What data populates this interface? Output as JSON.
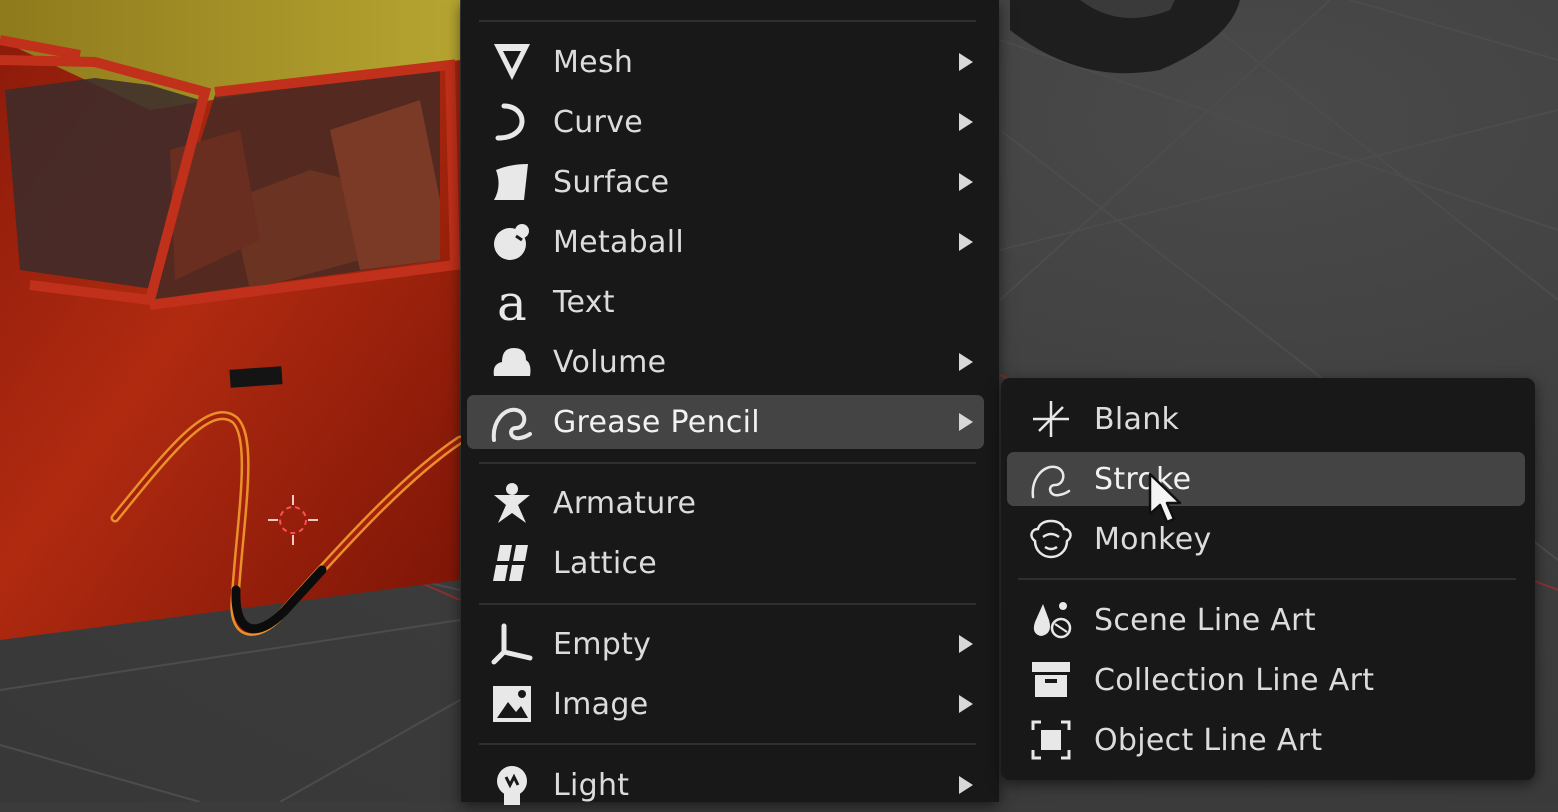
{
  "main_menu": {
    "items": [
      {
        "label": "Mesh",
        "icon": "mesh-icon",
        "submenu": true
      },
      {
        "label": "Curve",
        "icon": "curve-icon",
        "submenu": true
      },
      {
        "label": "Surface",
        "icon": "surface-icon",
        "submenu": true
      },
      {
        "label": "Metaball",
        "icon": "metaball-icon",
        "submenu": true
      },
      {
        "label": "Text",
        "icon": "text-icon",
        "submenu": false
      },
      {
        "label": "Volume",
        "icon": "volume-icon",
        "submenu": true
      },
      {
        "label": "Grease Pencil",
        "icon": "grease-pencil-icon",
        "submenu": true,
        "highlighted": true
      },
      {
        "label": "Armature",
        "icon": "armature-icon",
        "submenu": false
      },
      {
        "label": "Lattice",
        "icon": "lattice-icon",
        "submenu": false
      },
      {
        "label": "Empty",
        "icon": "empty-icon",
        "submenu": true
      },
      {
        "label": "Image",
        "icon": "image-icon",
        "submenu": true
      },
      {
        "label": "Light",
        "icon": "light-icon",
        "submenu": true
      }
    ]
  },
  "grease_pencil_menu": {
    "items": [
      {
        "label": "Blank",
        "icon": "blank-icon"
      },
      {
        "label": "Stroke",
        "icon": "stroke-icon",
        "highlighted": true
      },
      {
        "label": "Monkey",
        "icon": "monkey-icon"
      },
      {
        "label": "Scene Line Art",
        "icon": "scene-line-art-icon"
      },
      {
        "label": "Collection Line Art",
        "icon": "collection-line-art-icon"
      },
      {
        "label": "Object Line Art",
        "icon": "object-line-art-icon"
      }
    ]
  },
  "colors": {
    "menu_bg": "#181818",
    "highlight": "#444444",
    "text": "#dcdcdc",
    "selection_outline": "#e8902a",
    "car_body": "#a8260e"
  }
}
